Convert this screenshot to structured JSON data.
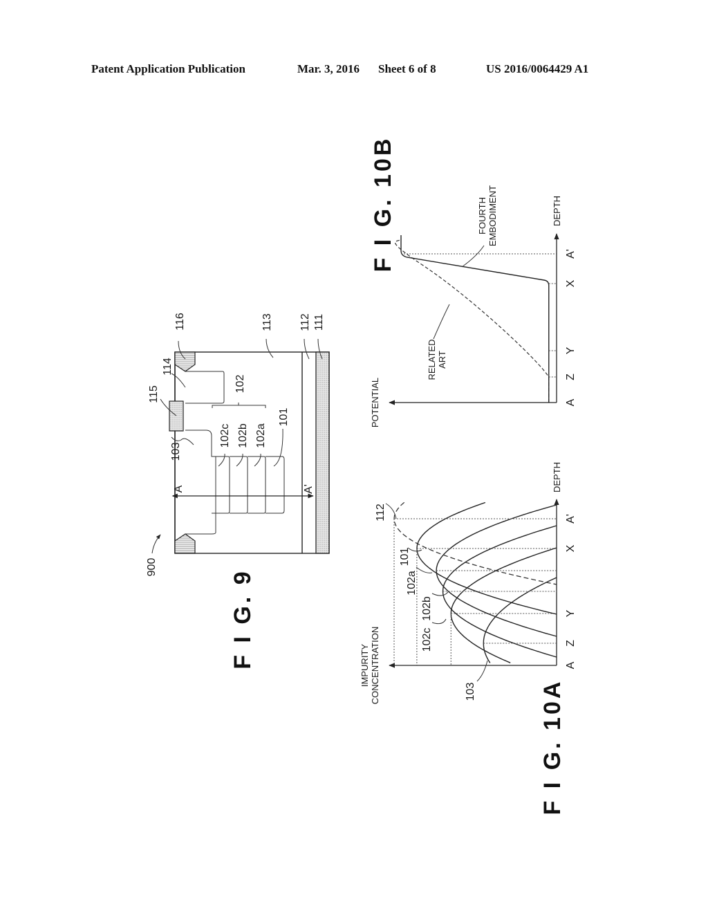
{
  "header": {
    "publication_type": "Patent Application Publication",
    "date": "Mar. 3, 2016",
    "sheet": "Sheet 6 of 8",
    "patent_number": "US 2016/0064429 A1"
  },
  "fig9": {
    "title": "F I G. 9",
    "device_ref": "900",
    "section_start": "A",
    "section_end": "A'",
    "labels": {
      "l101": "101",
      "l102": "102",
      "l102a": "102a",
      "l102b": "102b",
      "l102c": "102c",
      "l103": "103",
      "l111": "111",
      "l112": "112",
      "l113": "113",
      "l114": "114",
      "l115": "115",
      "l116": "116"
    }
  },
  "fig10a": {
    "title": "F I G. 10A",
    "y_axis_label_line1": "IMPURITY",
    "y_axis_label_line2": "CONCENTRATION",
    "x_axis_label": "DEPTH",
    "ticks": [
      "A",
      "Z",
      "Y",
      "X",
      "A'"
    ],
    "curve_labels": {
      "c103": "103",
      "c102c": "102c",
      "c102b": "102b",
      "c102a": "102a",
      "c101": "101",
      "c112": "112"
    }
  },
  "fig10b": {
    "title": "F I G. 10B",
    "y_axis_label": "POTENTIAL",
    "x_axis_label": "DEPTH",
    "ticks": [
      "A",
      "Z",
      "Y",
      "X",
      "A'"
    ],
    "series_labels": {
      "related_line1": "RELATED",
      "related_line2": "ART",
      "fourth_line1": "FOURTH",
      "fourth_line2": "EMBODIMENT"
    }
  },
  "chart_data": [
    {
      "type": "line",
      "title": "F I G. 10A",
      "xlabel": "DEPTH",
      "ylabel": "IMPURITY CONCENTRATION",
      "x_ticks": [
        "A",
        "Z",
        "Y",
        "X",
        "A'"
      ],
      "grid": false,
      "series": [
        {
          "name": "103",
          "style": "solid",
          "peak_at": "Z",
          "relative_peak": 0.45
        },
        {
          "name": "102c",
          "style": "solid",
          "peak_at": "Y",
          "relative_peak": 0.65
        },
        {
          "name": "102b",
          "style": "solid",
          "peak_between": [
            "Y",
            "X"
          ],
          "relative_peak": 0.7
        },
        {
          "name": "102a",
          "style": "solid",
          "peak_between": [
            "Y",
            "X"
          ],
          "relative_peak": 0.74
        },
        {
          "name": "101",
          "style": "solid",
          "peak_at": "X",
          "relative_peak": 0.86
        },
        {
          "name": "112",
          "style": "dashed",
          "peak_at": "A'",
          "relative_peak": 1.0
        }
      ]
    },
    {
      "type": "line",
      "title": "F I G. 10B",
      "xlabel": "DEPTH",
      "ylabel": "POTENTIAL",
      "x_ticks": [
        "A",
        "Z",
        "Y",
        "X",
        "A'"
      ],
      "grid": false,
      "series": [
        {
          "name": "RELATED ART",
          "style": "dashed",
          "description": "flat low potential from A to Z, gradual rise from Z to near A'",
          "points": [
            [
              "A",
              0.05
            ],
            [
              "Z",
              0.05
            ],
            [
              "Y",
              0.2
            ],
            [
              "X",
              0.75
            ],
            [
              "A'",
              1.0
            ]
          ]
        },
        {
          "name": "FOURTH EMBODIMENT",
          "style": "solid",
          "description": "flat low potential from A to X, steep rise from X to A'",
          "points": [
            [
              "A",
              0.05
            ],
            [
              "Z",
              0.05
            ],
            [
              "Y",
              0.05
            ],
            [
              "X",
              0.05
            ],
            [
              "A'",
              1.0
            ]
          ]
        }
      ]
    }
  ]
}
